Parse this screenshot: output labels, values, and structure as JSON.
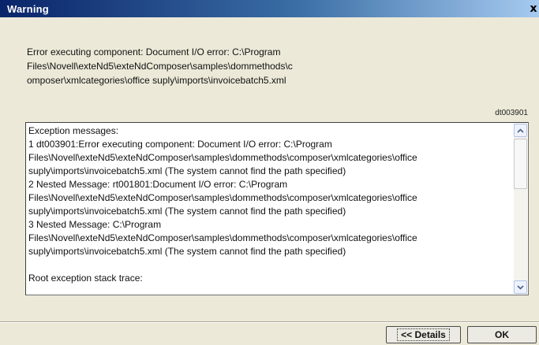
{
  "window": {
    "title": "Warning",
    "close_label": "x"
  },
  "error_message": {
    "lines": [
      "Error executing component: Document I/O error: C:\\Program",
      "Files\\Novell\\exteNd5\\exteNdComposer\\samples\\dommethods\\c",
      "omposer\\xmlcategories\\office suply\\imports\\invoicebatch5.xml"
    ]
  },
  "error_code": "dt003901",
  "details": {
    "lines": [
      "Exception messages:",
      "1 dt003901:Error executing component: Document I/O error: C:\\Program",
      "Files\\Novell\\exteNd5\\exteNdComposer\\samples\\dommethods\\composer\\xmlcategories\\office",
      "suply\\imports\\invoicebatch5.xml (The system cannot find the path specified)",
      "2 Nested Message: rt001801:Document I/O error: C:\\Program",
      "Files\\Novell\\exteNd5\\exteNdComposer\\samples\\dommethods\\composer\\xmlcategories\\office",
      "suply\\imports\\invoicebatch5.xml (The system cannot find the path specified)",
      "3 Nested Message: C:\\Program",
      "Files\\Novell\\exteNd5\\exteNdComposer\\samples\\dommethods\\composer\\xmlcategories\\office",
      "suply\\imports\\invoicebatch5.xml (The system cannot find the path specified)",
      "",
      "Root exception stack trace:"
    ]
  },
  "buttons": {
    "details_label": "<< Details",
    "ok_label": "OK"
  }
}
